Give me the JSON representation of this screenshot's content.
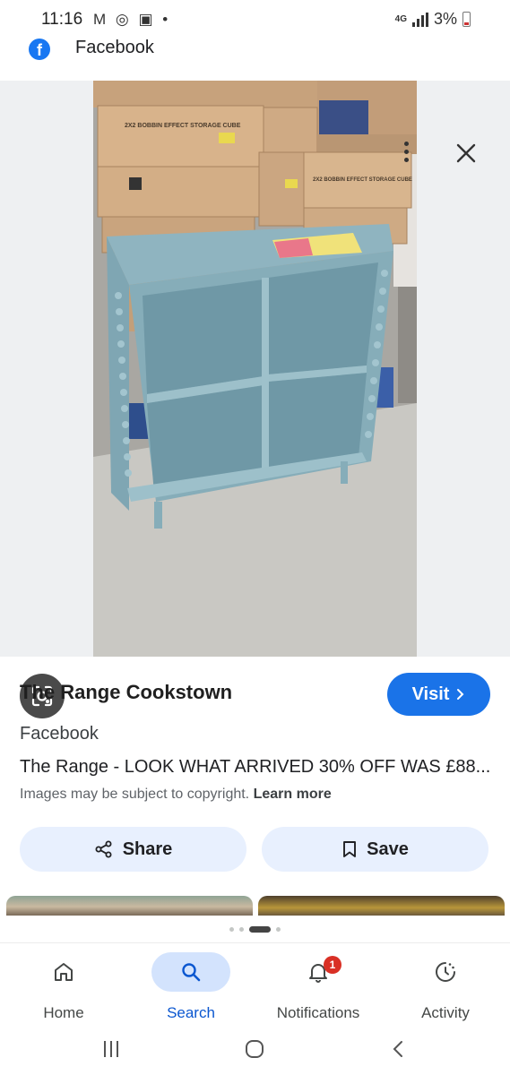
{
  "status_bar": {
    "time": "11:16",
    "left_icons": "M ◎ ▣ •",
    "network": "4G",
    "battery": "3%"
  },
  "header": {
    "title": "Facebook",
    "logo_letter": "f"
  },
  "image": {
    "box_label_1": "2X2 BOBBIN EFFECT STORAGE CUBE",
    "box_label_2": "2X2 BOBBIN EFFECT STORAGE CUBE"
  },
  "result": {
    "source_title": "The Range Cookstown",
    "visit_label": "Visit",
    "source_name": "Facebook",
    "title": "The Range - LOOK WHAT ARRIVED 30% OFF WAS £88...",
    "copyright_text": "Images may be subject to copyright.",
    "learn_more": "Learn more",
    "share_label": "Share",
    "save_label": "Save"
  },
  "bottom_nav": {
    "items": [
      {
        "label": "Home",
        "icon": "home-icon"
      },
      {
        "label": "Search",
        "icon": "search-icon"
      },
      {
        "label": "Notifications",
        "icon": "bell-icon",
        "badge": "1"
      },
      {
        "label": "Activity",
        "icon": "activity-icon"
      }
    ]
  },
  "colors": {
    "accent": "#1a73e8",
    "chip": "#e8f0fe",
    "active_nav": "#d3e3fd",
    "badge": "#d93025"
  }
}
